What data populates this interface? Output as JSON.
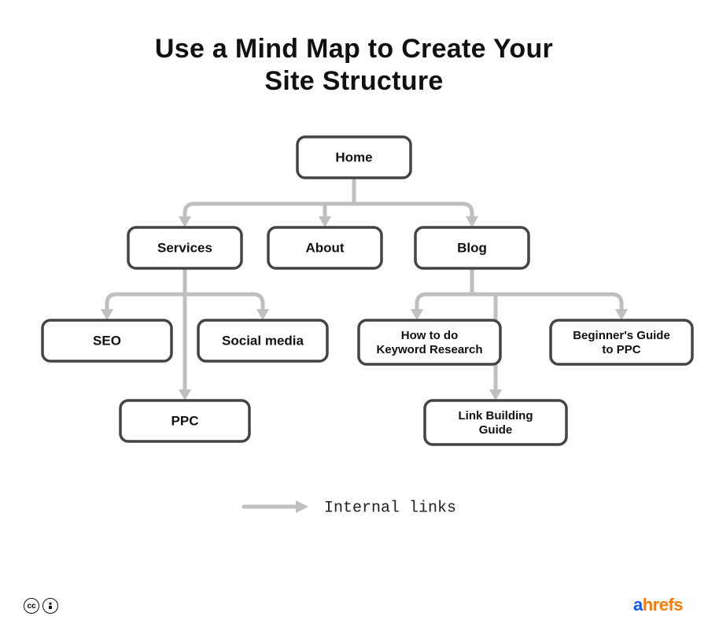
{
  "title_line1": "Use a Mind Map to Create Your",
  "title_line2": "Site Structure",
  "nodes": {
    "home": "Home",
    "services": "Services",
    "about": "About",
    "blog": "Blog",
    "seo": "SEO",
    "social": "Social media",
    "ppc": "PPC",
    "howto_l1": "How to do",
    "howto_l2": "Keyword Research",
    "beginner_l1": "Beginner's Guide",
    "beginner_l2": "to PPC",
    "link_l1": "Link Building",
    "link_l2": "Guide"
  },
  "legend": "Internal links",
  "brand_a": "a",
  "brand_rest": "hrefs",
  "license": {
    "cc": "cc",
    "by": "🄯"
  }
}
